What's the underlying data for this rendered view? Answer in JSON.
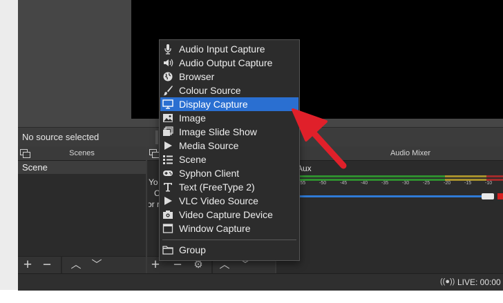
{
  "status": {
    "no_source": "No source selected",
    "live": "LIVE: 00:00"
  },
  "docks": {
    "scenes": {
      "title": "Scenes",
      "items": [
        "Scene"
      ]
    },
    "audio_mixer": {
      "title": "Audio Mixer",
      "channel": "Aux"
    }
  },
  "sources_partial_text": [
    "Yo",
    "C",
    "or r"
  ],
  "meter_ticks": [
    "-55",
    "-50",
    "-45",
    "-40",
    "-35",
    "-30",
    "-25",
    "-20",
    "-15",
    "-10"
  ],
  "context_menu": {
    "items": [
      {
        "label": "Audio Input Capture",
        "icon": "microphone-icon"
      },
      {
        "label": "Audio Output Capture",
        "icon": "speaker-icon"
      },
      {
        "label": "Browser",
        "icon": "globe-icon"
      },
      {
        "label": "Colour Source",
        "icon": "paintbrush-icon"
      },
      {
        "label": "Display Capture",
        "icon": "monitor-icon",
        "highlighted": true
      },
      {
        "label": "Image",
        "icon": "image-icon"
      },
      {
        "label": "Image Slide Show",
        "icon": "slideshow-icon"
      },
      {
        "label": "Media Source",
        "icon": "play-icon"
      },
      {
        "label": "Scene",
        "icon": "list-icon"
      },
      {
        "label": "Syphon Client",
        "icon": "gamepad-icon"
      },
      {
        "label": "Text (FreeType 2)",
        "icon": "text-icon"
      },
      {
        "label": "VLC Video Source",
        "icon": "play-icon"
      },
      {
        "label": "Video Capture Device",
        "icon": "camera-icon"
      },
      {
        "label": "Window Capture",
        "icon": "window-icon"
      }
    ],
    "group": {
      "label": "Group",
      "icon": "folder-icon"
    }
  },
  "colors": {
    "highlight": "#2a6fd1",
    "annotation_arrow": "#e0202a",
    "volume": "#2f7bd6"
  }
}
